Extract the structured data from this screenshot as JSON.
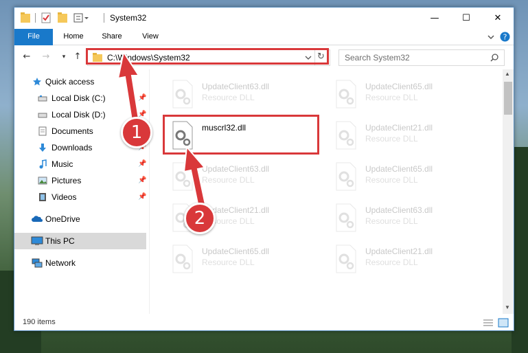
{
  "window": {
    "title": "System32",
    "controls": {
      "minimize": "—",
      "maximize": "☐",
      "close": "✕"
    }
  },
  "ribbon": {
    "tabs": [
      "File",
      "Home",
      "Share",
      "View"
    ]
  },
  "address": {
    "path": "C:\\Windows\\System32",
    "search_placeholder": "Search System32"
  },
  "nav": {
    "items": [
      {
        "label": "Quick access",
        "icon": "star-icon",
        "pinned": false
      },
      {
        "label": "Local Disk (C:)",
        "icon": "drive-icon",
        "pinned": true
      },
      {
        "label": "Local Disk (D:)",
        "icon": "drive-icon",
        "pinned": true
      },
      {
        "label": "Documents",
        "icon": "documents-icon",
        "pinned": true
      },
      {
        "label": "Downloads",
        "icon": "downloads-icon",
        "pinned": true
      },
      {
        "label": "Music",
        "icon": "music-icon",
        "pinned": true
      },
      {
        "label": "Pictures",
        "icon": "pictures-icon",
        "pinned": true
      },
      {
        "label": "Videos",
        "icon": "videos-icon",
        "pinned": true
      },
      {
        "label": "OneDrive",
        "icon": "cloud-icon",
        "pinned": false
      },
      {
        "label": "This PC",
        "icon": "computer-icon",
        "pinned": false
      },
      {
        "label": "Network",
        "icon": "network-icon",
        "pinned": false
      }
    ]
  },
  "files": [
    {
      "name": "UpdateClient63.dll",
      "type": "Resource DLL"
    },
    {
      "name": "UpdateClient65.dll",
      "type": "Resource DLL"
    },
    {
      "name": "muscrl32.dll",
      "type": ""
    },
    {
      "name": "UpdateClient21.dll",
      "type": "Resource DLL"
    },
    {
      "name": "UpdateClient63.dll",
      "type": "Resource DLL"
    },
    {
      "name": "UpdateClient65.dll",
      "type": "Resource DLL"
    },
    {
      "name": "UpdateClient21.dll",
      "type": "Resource DLL"
    },
    {
      "name": "UpdateClient63.dll",
      "type": "Resource DLL"
    },
    {
      "name": "UpdateClient65.dll",
      "type": "Resource DLL"
    },
    {
      "name": "UpdateClient21.dll",
      "type": "Resource DLL"
    }
  ],
  "status": {
    "count": "190 items"
  },
  "annotations": {
    "step1": "1",
    "step2": "2"
  },
  "colors": {
    "accent": "#1979ca",
    "highlight": "#d9383a"
  }
}
